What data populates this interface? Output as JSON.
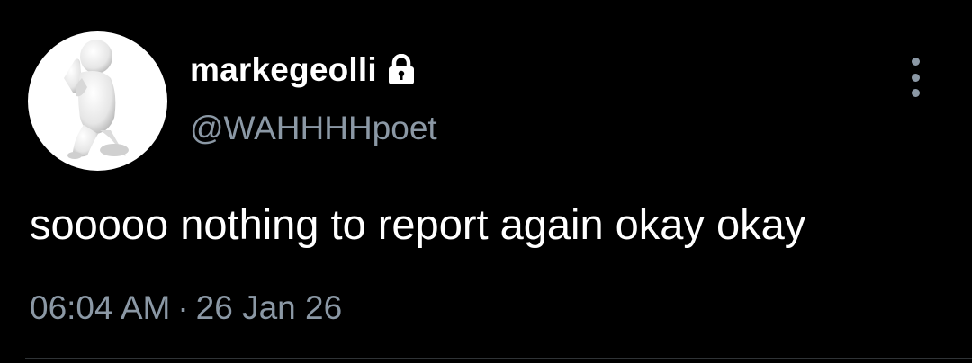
{
  "tweet": {
    "display_name": "markegeolli",
    "handle": "@WAHHHHpoet",
    "text": "sooooo nothing to report again okay okay",
    "time": "06:04 AM",
    "separator": "·",
    "date": "26 Jan 26"
  },
  "icons": {
    "avatar": "praying-figure-avatar",
    "protected": "lock-icon",
    "more": "more-vertical-icon"
  },
  "colors": {
    "background": "#000000",
    "primary_text": "#ffffff",
    "secondary_text": "#8b98a5",
    "divider": "#2f3336"
  }
}
